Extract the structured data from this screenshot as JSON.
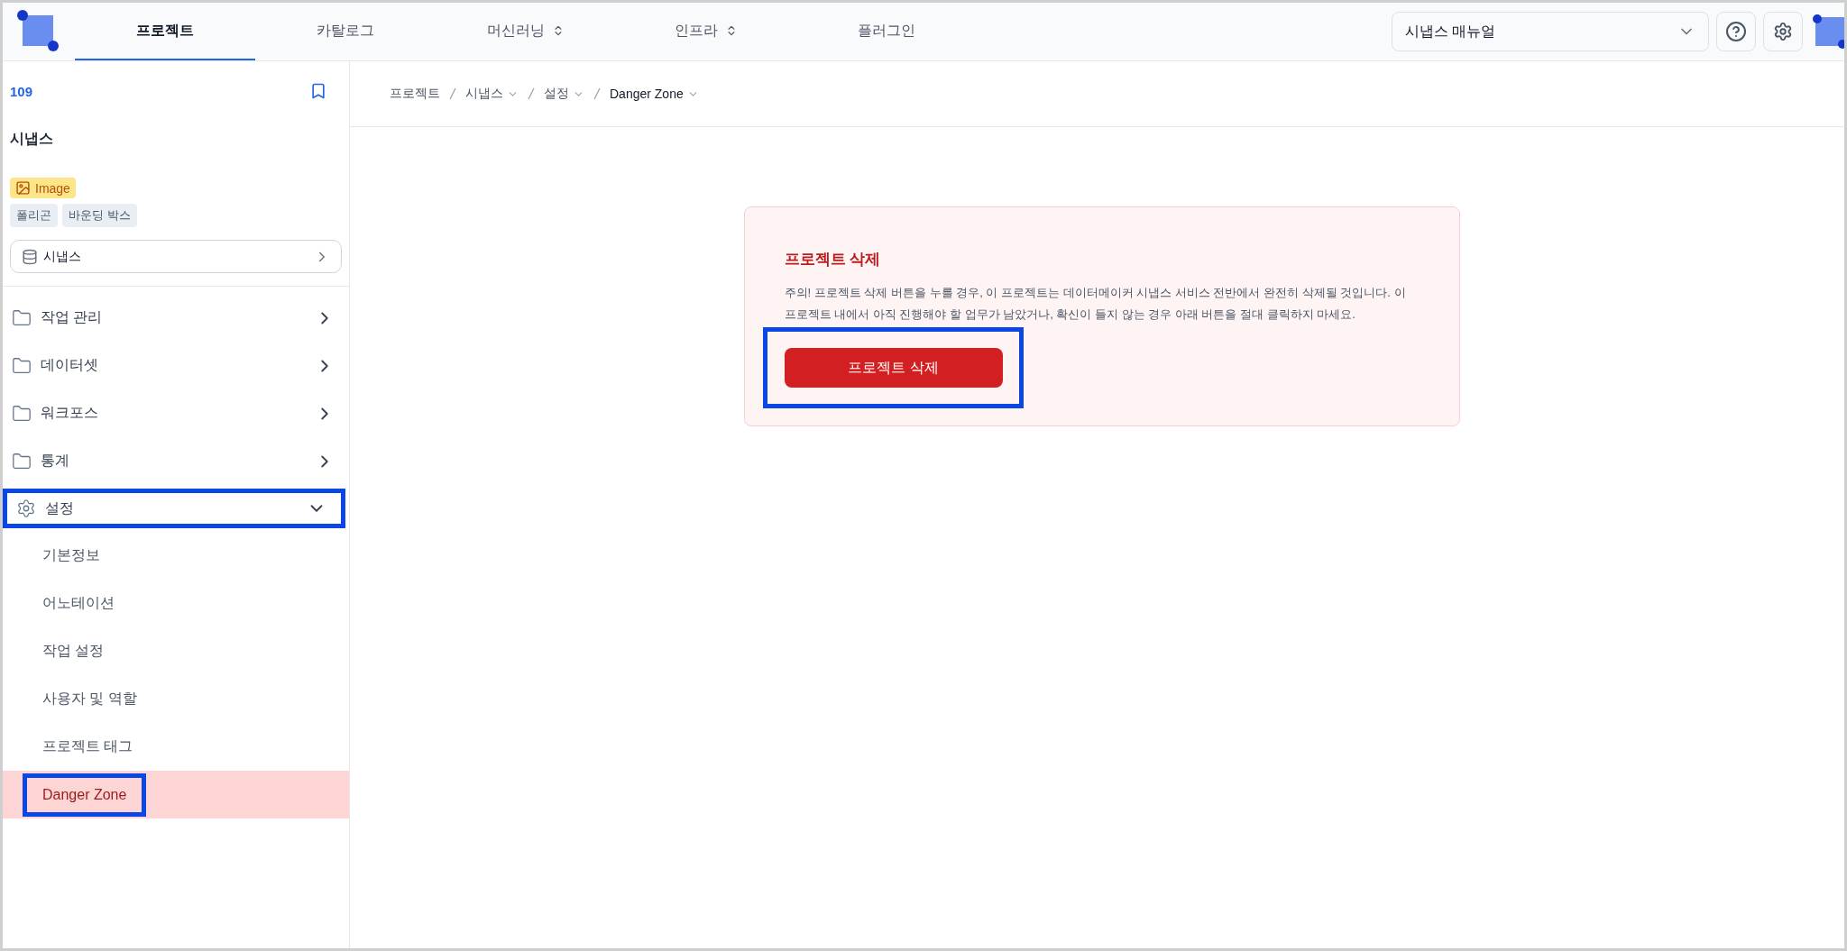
{
  "nav": {
    "tabs": [
      {
        "label": "프로젝트",
        "selected": true,
        "dropdown": false
      },
      {
        "label": "카탈로그",
        "selected": false,
        "dropdown": false
      },
      {
        "label": "머신러닝",
        "selected": false,
        "dropdown": true
      },
      {
        "label": "인프라",
        "selected": false,
        "dropdown": true
      },
      {
        "label": "플러그인",
        "selected": false,
        "dropdown": false
      }
    ],
    "manual_select": {
      "value": "시냅스 매뉴얼"
    }
  },
  "sidebar": {
    "project_id": "109",
    "project_name": "시냅스",
    "data_type": "Image",
    "tags": [
      "폴리곤",
      "바운딩 박스"
    ],
    "dataset": "시냅스",
    "items": [
      {
        "label": "작업 관리",
        "kind": "folder",
        "expanded": false,
        "highlighted": false
      },
      {
        "label": "데이터셋",
        "kind": "folder",
        "expanded": false,
        "highlighted": false
      },
      {
        "label": "워크포스",
        "kind": "folder",
        "expanded": false,
        "highlighted": false
      },
      {
        "label": "통계",
        "kind": "folder",
        "expanded": false,
        "highlighted": false
      },
      {
        "label": "설정",
        "kind": "settings",
        "expanded": true,
        "highlighted": true,
        "children": [
          {
            "label": "기본정보",
            "selected": false,
            "highlighted": false
          },
          {
            "label": "어노테이션",
            "selected": false,
            "highlighted": false
          },
          {
            "label": "작업 설정",
            "selected": false,
            "highlighted": false
          },
          {
            "label": "사용자 및 역할",
            "selected": false,
            "highlighted": false
          },
          {
            "label": "프로젝트 태그",
            "selected": false,
            "highlighted": false
          },
          {
            "label": "Danger Zone",
            "selected": true,
            "highlighted": true
          }
        ]
      }
    ]
  },
  "breadcrumb": [
    {
      "label": "프로젝트",
      "dropdown": false
    },
    {
      "label": "시냅스",
      "dropdown": true
    },
    {
      "label": "설정",
      "dropdown": true
    },
    {
      "label": "Danger Zone",
      "dropdown": true
    }
  ],
  "danger_card": {
    "title": "프로젝트 삭제",
    "message": "주의! 프로젝트 삭제 버튼을 누를 경우, 이 프로젝트는 데이터메이커 시냅스 서비스 전반에서 완전히 삭제될 것입니다. 이 프로젝트 내에서 아직 진행해야 할 업무가 남았거나, 확신이 들지 않는 경우 아래 버튼을 절대 클릭하지 마세요.",
    "button": {
      "label": "프로젝트 삭제",
      "highlighted": true
    }
  }
}
